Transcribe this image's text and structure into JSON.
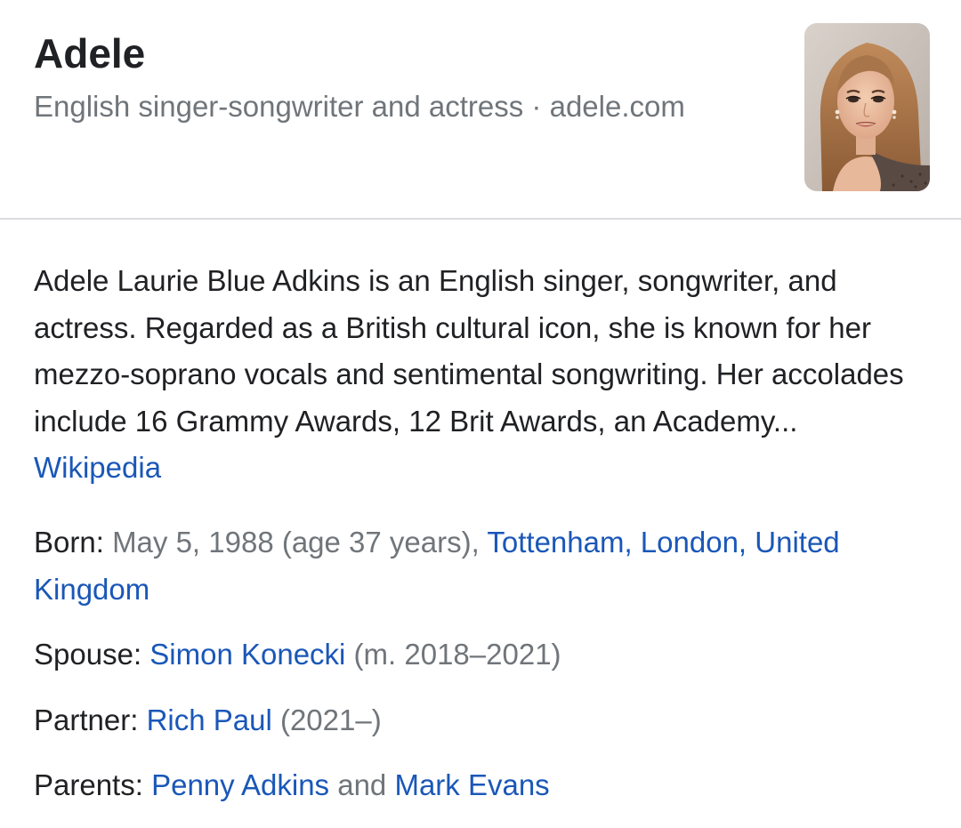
{
  "entity": {
    "name": "Adele",
    "subtitle": {
      "description": "English singer-songwriter and actress",
      "separator": " · ",
      "website": "adele.com"
    },
    "thumbnail_alt": "Adele"
  },
  "about": {
    "text": "Adele Laurie Blue Adkins is an English singer, songwriter, and actress. Regarded as a British cultural icon, she is known for her mezzo-soprano vocals and sentimental songwriting. Her accolades include 16 Grammy Awards, 12 Brit Awards, an Academy...",
    "source_link": "Wikipedia"
  },
  "facts": {
    "born": {
      "label": "Born",
      "colon": ": ",
      "date": "May 5, 1988 (age 37 years), ",
      "place_link": "Tottenham, London, United Kingdom"
    },
    "spouse": {
      "label": "Spouse",
      "colon": ": ",
      "name_link": "Simon Konecki",
      "detail": " (m. 2018–2021)"
    },
    "partner": {
      "label": "Partner",
      "colon": ": ",
      "name_link": "Rich Paul",
      "detail": " (2021–)"
    },
    "parents": {
      "label": "Parents",
      "colon": ": ",
      "first_link": "Penny Adkins",
      "conjunction": " and ",
      "second_link": "Mark Evans"
    }
  },
  "colors": {
    "link": "#1a57b8",
    "muted": "#70757a",
    "text": "#202124",
    "divider": "#dadce0"
  }
}
